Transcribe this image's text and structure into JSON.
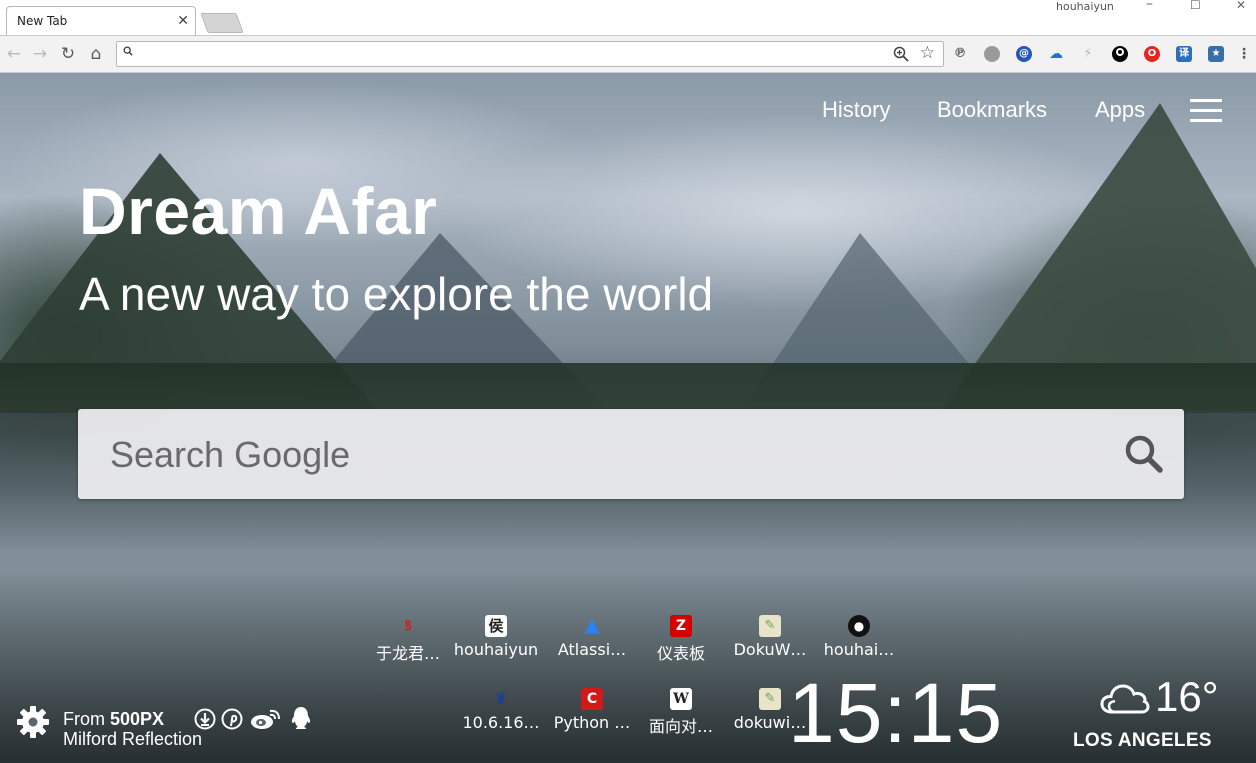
{
  "browser": {
    "tab_title": "New Tab",
    "profile_name": "houhaiyun",
    "omnibox_value": "",
    "extensions": [
      "translate-icon",
      "ghostery-icon",
      "at-icon",
      "cloud-icon",
      "lightning-icon",
      "record-icon",
      "opera-icon",
      "dictionary-icon",
      "star-bookmark-icon"
    ]
  },
  "nav": {
    "history": "History",
    "bookmarks": "Bookmarks",
    "apps": "Apps"
  },
  "hero": {
    "title": "Dream Afar",
    "subtitle": "A new way to explore the world"
  },
  "search": {
    "placeholder": "Search Google"
  },
  "top_sites": [
    {
      "label": "于龙君…",
      "icon": "dragon-icon",
      "color": "#c62828"
    },
    {
      "label": "houhaiyun",
      "icon": "hou-icon",
      "color": "#222222"
    },
    {
      "label": "Atlassi…",
      "icon": "atlassian-icon",
      "color": "#2684ff"
    },
    {
      "label": "仪表板",
      "icon": "zabbix-icon",
      "color": "#d40000"
    },
    {
      "label": "DokuW…",
      "icon": "dokuwiki-icon",
      "color": "#6aa84f"
    },
    {
      "label": "houhai…",
      "icon": "github-icon",
      "color": "#111111"
    },
    {
      "label": "10.6.16…",
      "icon": "jenkins-icon",
      "color": "#1f3f8f"
    },
    {
      "label": "Python …",
      "icon": "c-icon",
      "color": "#d21919"
    },
    {
      "label": "面向对…",
      "icon": "wikipedia-icon",
      "color": "#ffffff"
    },
    {
      "label": "dokuwi…",
      "icon": "dokuwiki-icon",
      "color": "#6aa84f"
    }
  ],
  "credit": {
    "from_prefix": "From ",
    "source": "500PX",
    "photo_title": "Milford Reflection"
  },
  "clock": "15:15",
  "weather": {
    "temperature": "16°",
    "city": "LOS ANGELES",
    "icon": "cloud-icon"
  }
}
